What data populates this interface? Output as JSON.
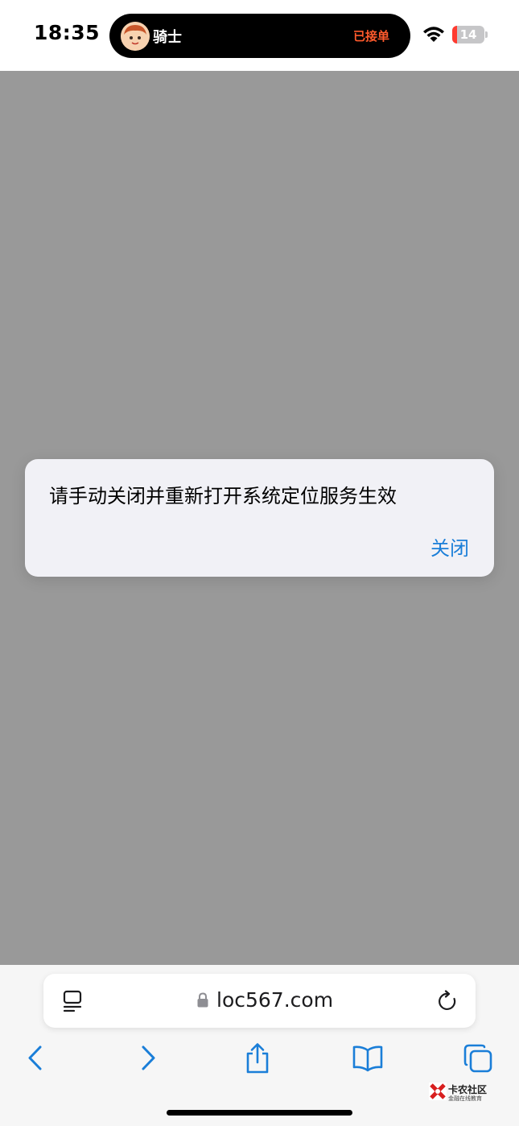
{
  "status_bar": {
    "time": "18:35",
    "island": {
      "label": "骑士",
      "status": "已接单",
      "status_color": "#ff5a2c"
    },
    "battery": {
      "level": 14,
      "label": "14",
      "level_color": "#ff3b30"
    },
    "icons": [
      "wifi-icon",
      "battery-icon"
    ]
  },
  "alert": {
    "message": "请手动关闭并重新打开系统定位服务生效",
    "button_label": "关闭",
    "button_color": "#1a7ed8"
  },
  "browser": {
    "url": "loc567.com",
    "address_icons": [
      "reader-icon",
      "lock-icon",
      "reload-icon"
    ],
    "toolbar_icons": [
      "back-icon",
      "forward-icon",
      "share-icon",
      "bookmarks-icon",
      "tabs-icon"
    ],
    "accent_color": "#1a7ed8"
  },
  "watermark": {
    "title": "卡农社区",
    "subtitle": "金融在线教育"
  }
}
